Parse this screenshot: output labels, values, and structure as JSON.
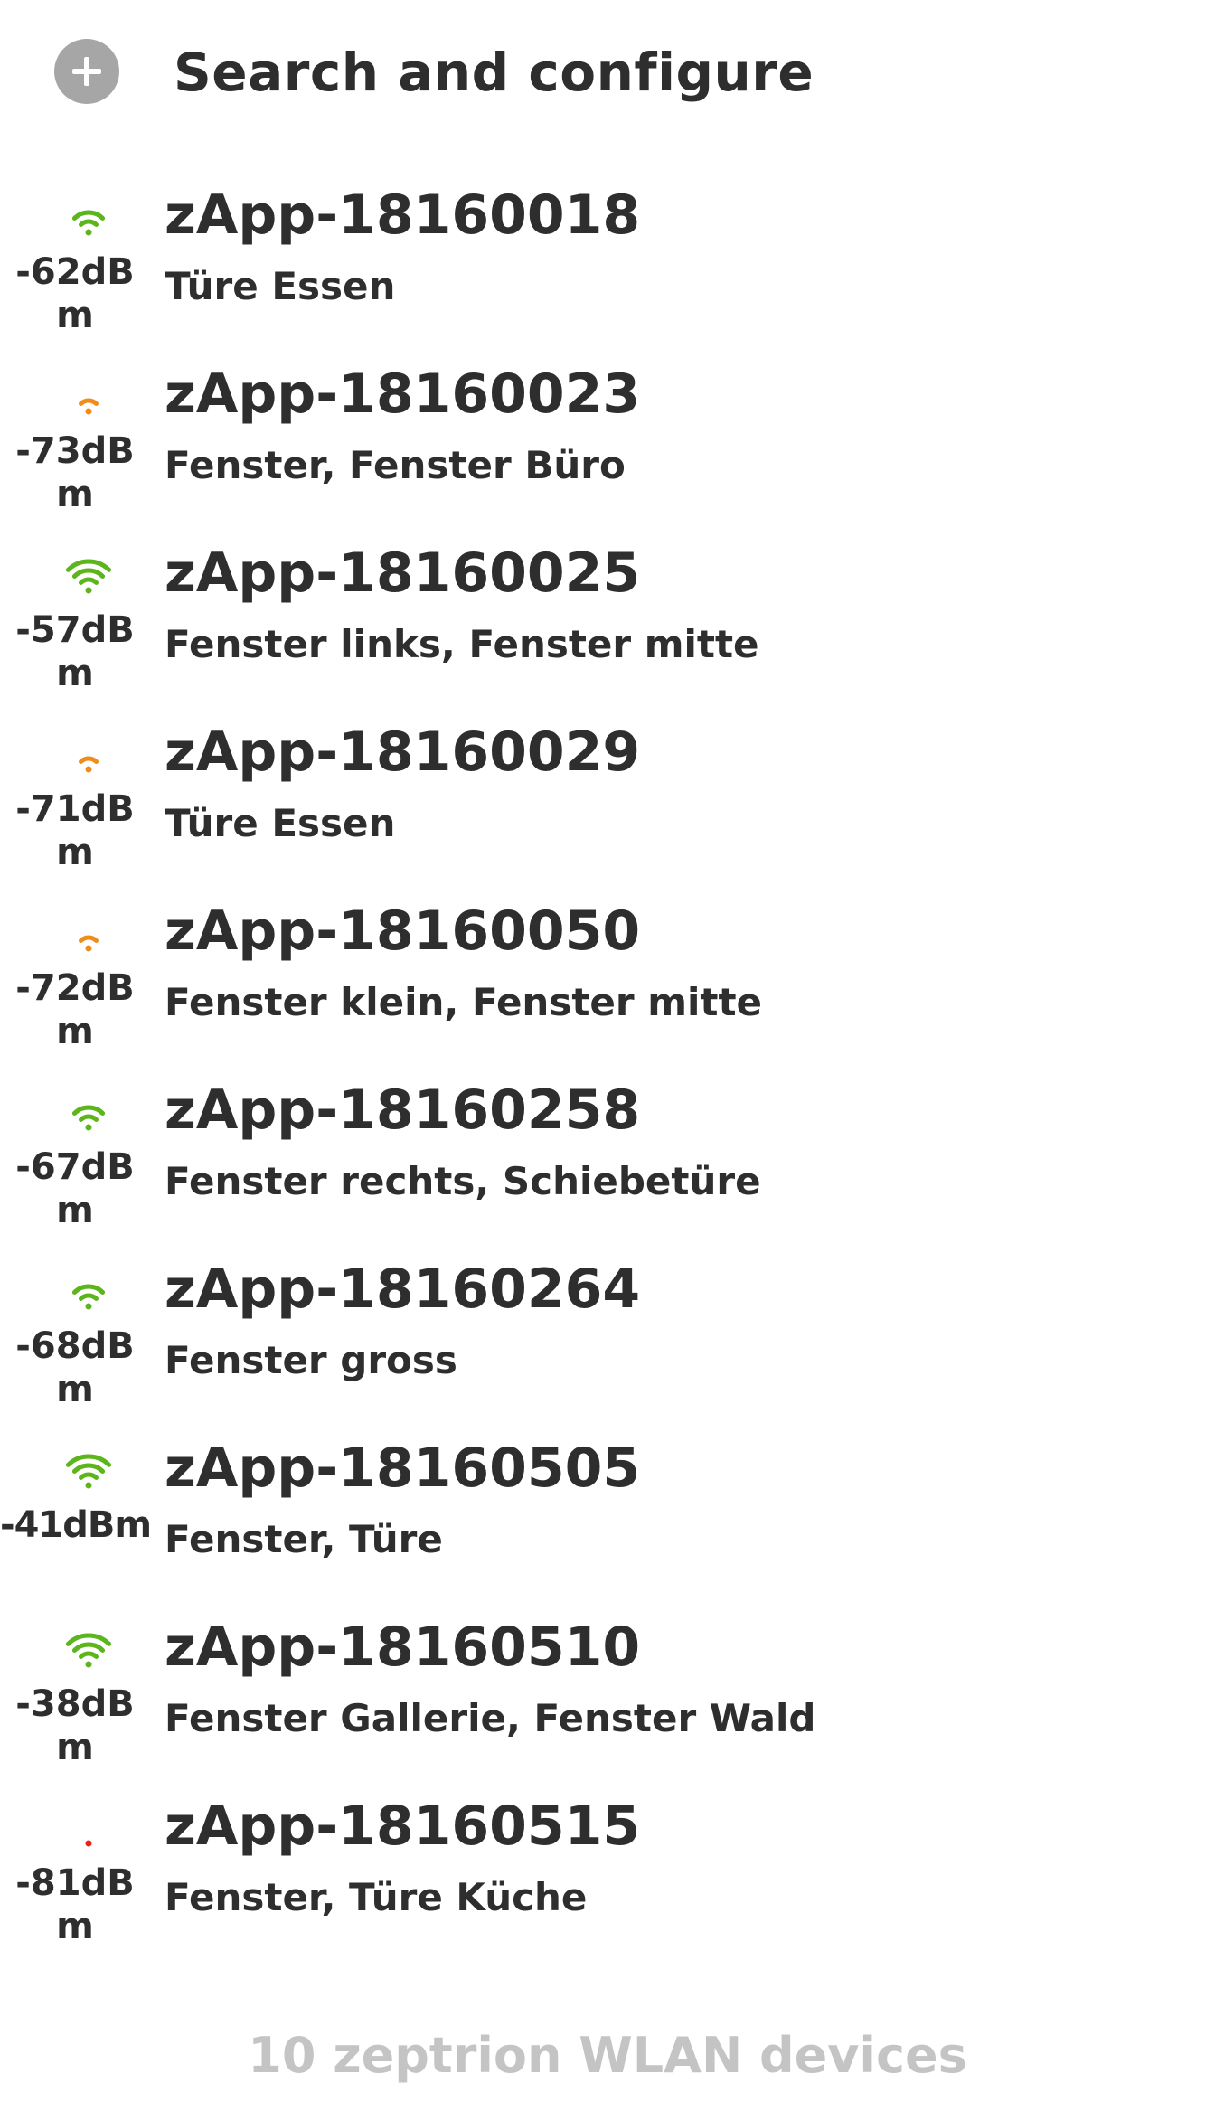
{
  "header": {
    "title": "Search and configure",
    "icon": "add-circle-icon"
  },
  "colors": {
    "strong": "#5cb51a",
    "medium": "#f08c1a",
    "weak": "#e8221c",
    "text": "#2e2e2e",
    "footer": "#c4c4c4",
    "icon_bg": "#a6a6a6"
  },
  "devices": [
    {
      "name": "zApp-18160018",
      "description": "Türe Essen",
      "signal": "-62dBm",
      "signal_label": "-62dBm",
      "bars": 3,
      "quality": "strong"
    },
    {
      "name": "zApp-18160023",
      "description": "Fenster, Fenster Büro",
      "signal": "-73dBm",
      "signal_label": "-73dBm",
      "bars": 2,
      "quality": "medium"
    },
    {
      "name": "zApp-18160025",
      "description": "Fenster links, Fenster mitte",
      "signal": "-57dBm",
      "signal_label": "-57dBm",
      "bars": 4,
      "quality": "strong"
    },
    {
      "name": "zApp-18160029",
      "description": "Türe Essen",
      "signal": "-71dBm",
      "signal_label": "-71dBm",
      "bars": 2,
      "quality": "medium"
    },
    {
      "name": "zApp-18160050",
      "description": "Fenster klein, Fenster mitte",
      "signal": "-72dBm",
      "signal_label": "-72dBm",
      "bars": 2,
      "quality": "medium"
    },
    {
      "name": "zApp-18160258",
      "description": "Fenster rechts, Schiebetüre",
      "signal": "-67dBm",
      "signal_label": "-67dBm",
      "bars": 3,
      "quality": "strong"
    },
    {
      "name": "zApp-18160264",
      "description": "Fenster gross",
      "signal": "-68dBm",
      "signal_label": "-68dBm",
      "bars": 3,
      "quality": "strong"
    },
    {
      "name": "zApp-18160505",
      "description": "Fenster, Türe",
      "signal": "-41dBm",
      "signal_label": "-41dBm",
      "bars": 4,
      "quality": "strong"
    },
    {
      "name": "zApp-18160510",
      "description": "Fenster Gallerie, Fenster Wald",
      "signal": "-38dBm",
      "signal_label": "-38dBm",
      "bars": 4,
      "quality": "strong"
    },
    {
      "name": "zApp-18160515",
      "description": "Fenster, Türe Küche",
      "signal": "-81dBm",
      "signal_label": "-81dBm",
      "bars": 1,
      "quality": "weak"
    }
  ],
  "footer": {
    "text": "10 zeptrion WLAN devices"
  }
}
